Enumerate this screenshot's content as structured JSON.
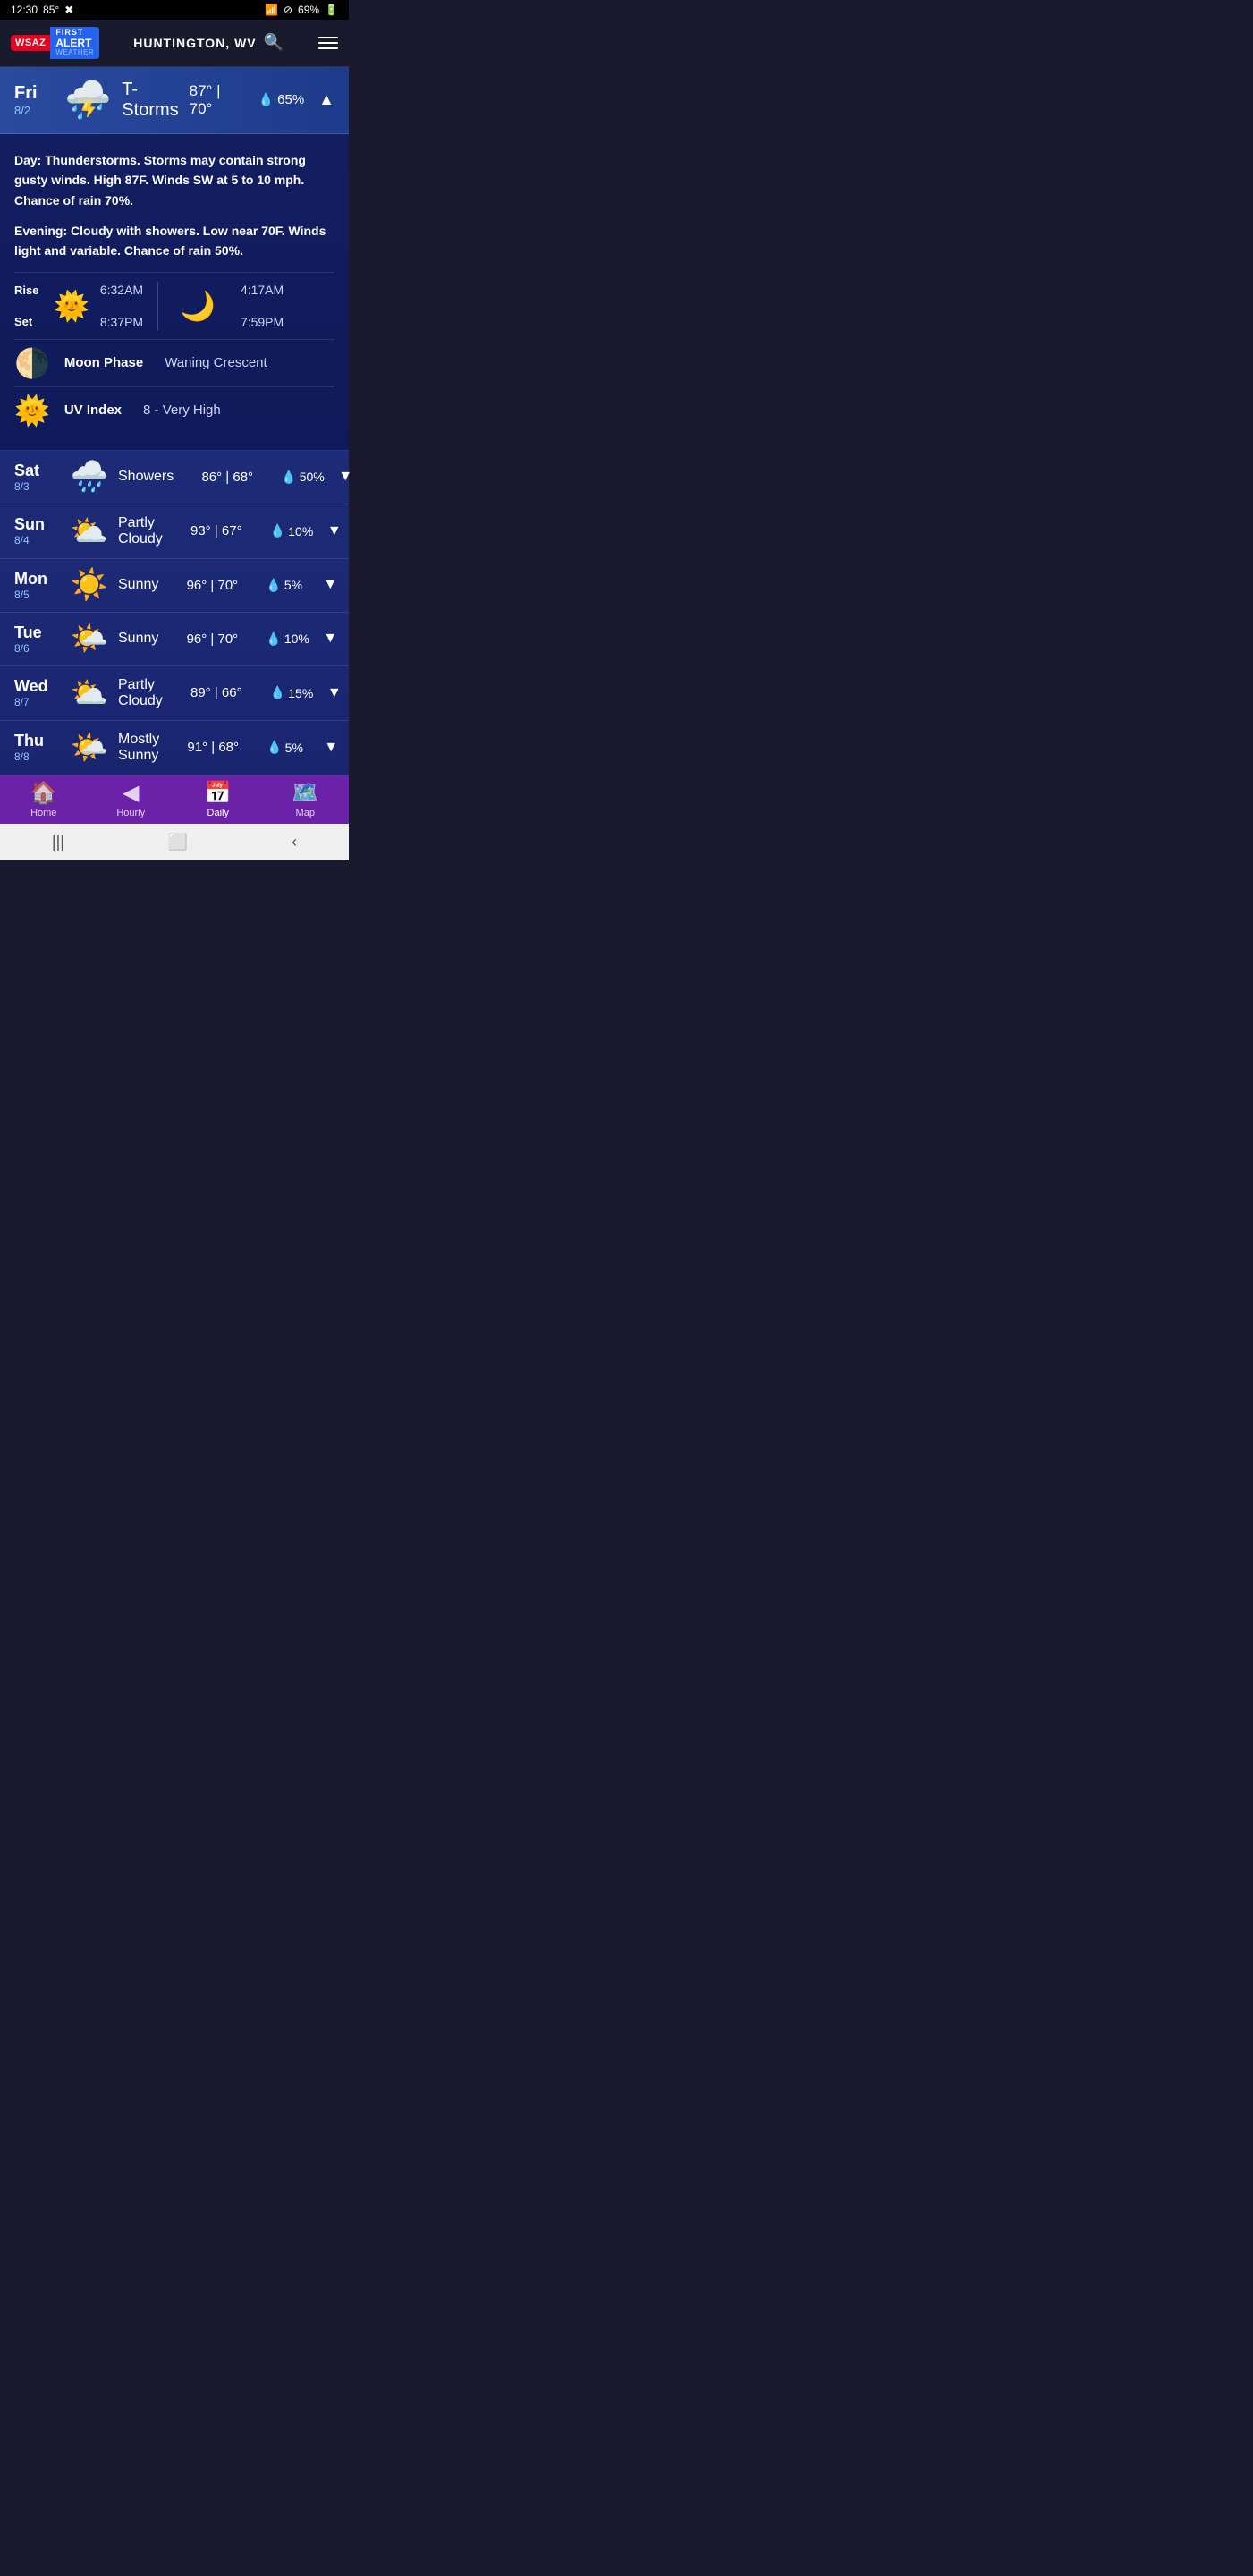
{
  "statusBar": {
    "time": "12:30",
    "temp": "85°",
    "batteryPct": "69%"
  },
  "header": {
    "location": "HUNTINGTON, WV",
    "searchIcon": "search",
    "menuIcon": "menu"
  },
  "currentDay": {
    "dayName": "Fri",
    "dayNum": "8/2",
    "condition": "T-Storms",
    "highTemp": "87°",
    "lowTemp": "70°",
    "precipChance": "65%",
    "expanded": true,
    "dayDetail": "Thunderstorms. Storms may contain strong gusty winds. High 87F. Winds SW at 5 to 10 mph. Chance of rain 70%.",
    "eveningDetail": "Cloudy with showers. Low near 70F. Winds light and variable. Chance of rain 50%.",
    "sunrise": "6:32AM",
    "sunset": "8:37PM",
    "moonrise": "4:17AM",
    "moonset": "7:59PM",
    "moonPhase": "Waning Crescent",
    "uvIndex": "8 - Very High"
  },
  "forecast": [
    {
      "dayName": "Sat",
      "dayNum": "8/3",
      "condition": "Showers",
      "highTemp": "86°",
      "lowTemp": "68°",
      "precipChance": "50%",
      "icon": "🌧️"
    },
    {
      "dayName": "Sun",
      "dayNum": "8/4",
      "condition": "Partly Cloudy",
      "highTemp": "93°",
      "lowTemp": "67°",
      "precipChance": "10%",
      "icon": "⛅"
    },
    {
      "dayName": "Mon",
      "dayNum": "8/5",
      "condition": "Sunny",
      "highTemp": "96°",
      "lowTemp": "70°",
      "precipChance": "5%",
      "icon": "☀️"
    },
    {
      "dayName": "Tue",
      "dayNum": "8/6",
      "condition": "Sunny",
      "highTemp": "96°",
      "lowTemp": "70°",
      "precipChance": "10%",
      "icon": "🌤️"
    },
    {
      "dayName": "Wed",
      "dayNum": "8/7",
      "condition": "Partly Cloudy",
      "highTemp": "89°",
      "lowTemp": "66°",
      "precipChance": "15%",
      "icon": "⛅"
    },
    {
      "dayName": "Thu",
      "dayNum": "8/8",
      "condition": "Mostly Sunny",
      "highTemp": "91°",
      "lowTemp": "68°",
      "precipChance": "5%",
      "icon": "🌤️"
    }
  ],
  "bottomNav": {
    "items": [
      {
        "label": "Home",
        "icon": "🏠",
        "active": false
      },
      {
        "label": "Hourly",
        "icon": "◀",
        "active": false
      },
      {
        "label": "Daily",
        "icon": "📅",
        "active": true
      },
      {
        "label": "Map",
        "icon": "🗺️",
        "active": false
      }
    ]
  },
  "riseLabel": "Rise",
  "setLabel": "Set",
  "moonPhaseLabel": "Moon Phase",
  "uvIndexLabel": "UV Index",
  "dayPrefix": "Day:",
  "eveningPrefix": "Evening:"
}
